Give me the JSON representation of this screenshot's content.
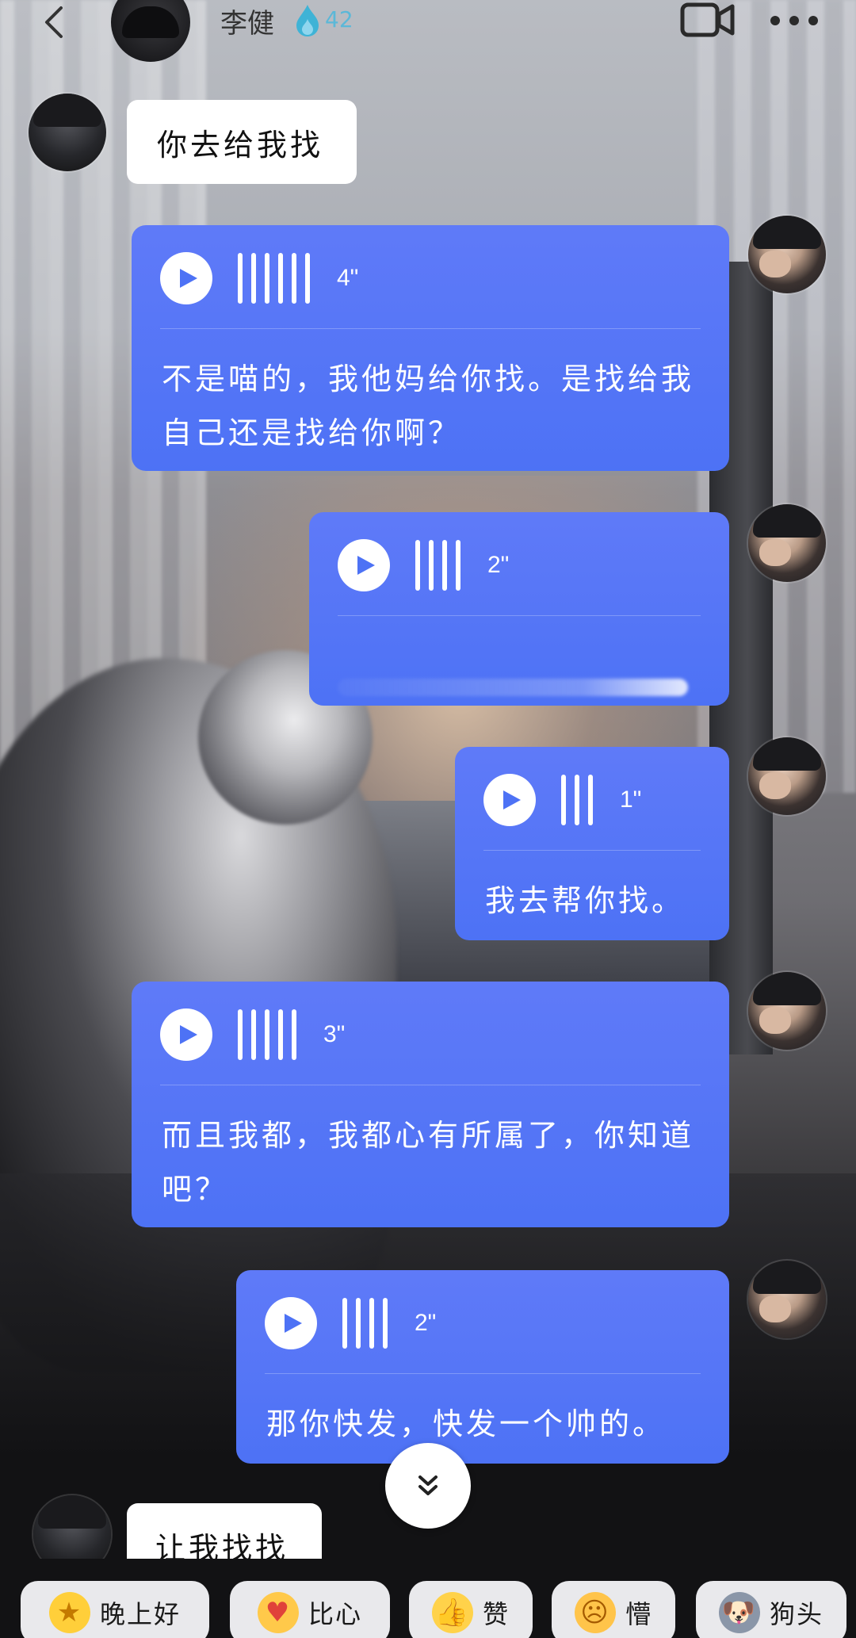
{
  "header": {
    "contact_name": "李健",
    "streak_count": "42"
  },
  "messages": [
    {
      "side": "left",
      "type": "text",
      "text": "你去给我找"
    },
    {
      "side": "right",
      "type": "voice",
      "duration": "4\"",
      "transcript": "不是喵的，我他妈给你找。是找给我自己还是找给你啊？"
    },
    {
      "side": "right",
      "type": "voice",
      "duration": "2\"",
      "transcript": ""
    },
    {
      "side": "right",
      "type": "voice",
      "duration": "1\"",
      "transcript": "我去帮你找。"
    },
    {
      "side": "right",
      "type": "voice",
      "duration": "3\"",
      "transcript": "而且我都，我都心有所属了，你知道吧？"
    },
    {
      "side": "right",
      "type": "voice",
      "duration": "2\"",
      "transcript": "那你快发，快发一个帅的。"
    },
    {
      "side": "left",
      "type": "text",
      "text": "让我找找"
    }
  ],
  "quick_replies": [
    {
      "label": "晚上好",
      "icon": "star-face-icon"
    },
    {
      "label": "比心",
      "icon": "heart-hand-icon"
    },
    {
      "label": "赞",
      "icon": "thumbs-up-icon"
    },
    {
      "label": "懵",
      "icon": "dazed-face-icon"
    },
    {
      "label": "狗头",
      "icon": "doge-icon"
    }
  ],
  "colors": {
    "voice_bubble": "#4d72f5",
    "text_bubble": "#ffffff",
    "chip_bg": "#e9e9ec",
    "streak_flame": "#3fb3d6"
  }
}
